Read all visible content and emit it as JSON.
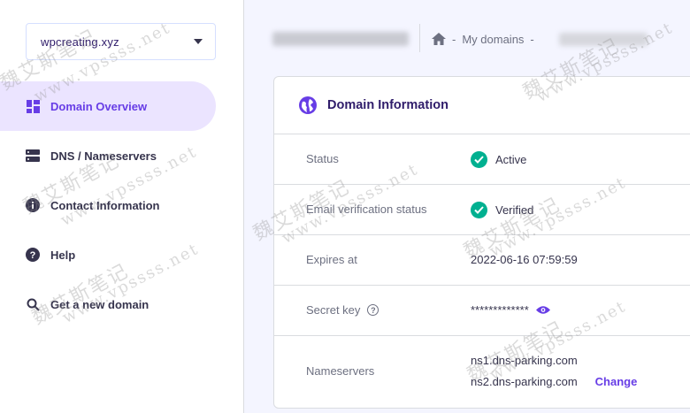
{
  "sidebar": {
    "domain_select": "wpcreating.xyz",
    "items": [
      {
        "label": "Domain Overview",
        "icon": "dashboard-icon",
        "active": true
      },
      {
        "label": "DNS / Nameservers",
        "icon": "server-icon",
        "active": false
      },
      {
        "label": "Contact Information",
        "icon": "info-icon",
        "active": false
      },
      {
        "label": "Help",
        "icon": "question-icon",
        "active": false
      },
      {
        "label": "Get a new domain",
        "icon": "search-icon",
        "active": false
      }
    ]
  },
  "breadcrumb": {
    "home_icon": "home-icon",
    "sep1": "-",
    "my_domains": "My domains",
    "sep2": "-"
  },
  "card": {
    "title": "Domain Information",
    "title_icon": "globe-icon",
    "rows": [
      {
        "label": "Status",
        "value": "Active"
      },
      {
        "label": "Email verification status",
        "value": "Verified"
      },
      {
        "label": "Expires at",
        "value": "2022-06-16 07:59:59"
      },
      {
        "label": "Secret key",
        "value": "*************"
      },
      {
        "label": "Nameservers",
        "value1": "ns1.dns-parking.com",
        "value2": "ns2.dns-parking.com",
        "action": "Change"
      }
    ]
  },
  "watermark": {
    "cn": "魏艾斯笔记",
    "url": "www.vpssss.net"
  },
  "colors": {
    "accent": "#673de6",
    "active_bg": "#ebe4ff",
    "success": "#00b090",
    "text_dark": "#2f1c6a",
    "text_muted": "#6d7081",
    "page_bg": "#f4f5ff"
  }
}
